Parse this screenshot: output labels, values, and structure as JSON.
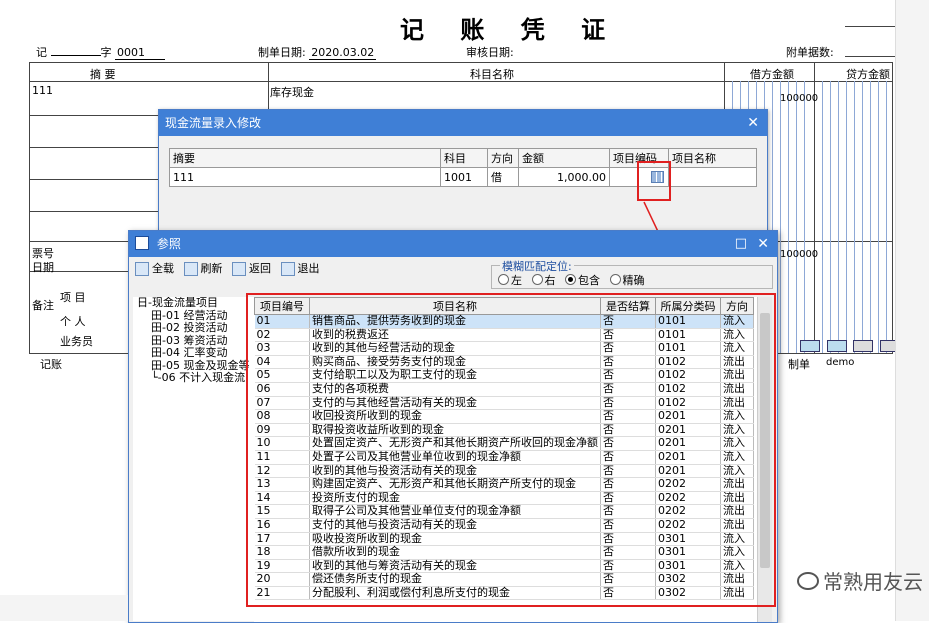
{
  "voucher": {
    "title": "记 账 凭 证",
    "type_label": "记",
    "num_prefix": "字",
    "num_value": "0001",
    "make_date_label": "制单日期:",
    "make_date": "2020.03.02",
    "audit_date_label": "审核日期:",
    "attach_label": "附单据数:",
    "col_summary": "摘 要",
    "col_account": "科目名称",
    "col_debit": "借方金额",
    "col_credit": "贷方金额",
    "row1_summary": "111",
    "row1_account": "库存现金",
    "row1_debit": "100000",
    "total_debit": "100000",
    "bill_no_label": "票号",
    "date_label": "日期",
    "remark_label": "备注",
    "project_label": "项 目",
    "person_label": "个 人",
    "salesman_label": "业务员",
    "bookkeep_label": "记账",
    "maker_label": "制单",
    "maker_value": "demo"
  },
  "cashflow_dialog": {
    "title": "现金流量录入修改",
    "headers": [
      "摘要",
      "科目",
      "方向",
      "金额",
      "项目编码",
      "项目名称"
    ],
    "row": {
      "summary": "111",
      "account": "1001",
      "direction": "借",
      "amount": "1,000.00",
      "code": "",
      "name": ""
    }
  },
  "ref_dialog": {
    "title": "参照",
    "toolbar": [
      "全载",
      "刷新",
      "返回",
      "退出"
    ],
    "fuzzy_label": "模糊匹配定位:",
    "radio_options": [
      "左",
      "右",
      "包含",
      "精确"
    ],
    "radio_selected": 2,
    "tree": [
      "日-现金流量项目",
      "田-01 经营活动",
      "田-02 投资活动",
      "田-03 筹资活动",
      "田-04 汇率变动",
      "田-05 现金及现金等",
      "└-06 不计入现金流"
    ],
    "columns": [
      "项目编号",
      "项目名称",
      "是否结算",
      "所属分类码",
      "方向"
    ],
    "rows": [
      [
        "01",
        "销售商品、提供劳务收到的现金",
        "否",
        "0101",
        "流入"
      ],
      [
        "02",
        "收到的税费返还",
        "否",
        "0101",
        "流入"
      ],
      [
        "03",
        "收到的其他与经营活动的现金",
        "否",
        "0101",
        "流入"
      ],
      [
        "04",
        "购买商品、接受劳务支付的现金",
        "否",
        "0102",
        "流出"
      ],
      [
        "05",
        "支付给职工以及为职工支付的现金",
        "否",
        "0102",
        "流出"
      ],
      [
        "06",
        "支付的各项税费",
        "否",
        "0102",
        "流出"
      ],
      [
        "07",
        "支付的与其他经营活动有关的现金",
        "否",
        "0102",
        "流出"
      ],
      [
        "08",
        "收回投资所收到的现金",
        "否",
        "0201",
        "流入"
      ],
      [
        "09",
        "取得投资收益所收到的现金",
        "否",
        "0201",
        "流入"
      ],
      [
        "10",
        "处置固定资产、无形资产和其他长期资产所收回的现金净额",
        "否",
        "0201",
        "流入"
      ],
      [
        "11",
        "处置子公司及其他营业单位收到的现金净额",
        "否",
        "0201",
        "流入"
      ],
      [
        "12",
        "收到的其他与投资活动有关的现金",
        "否",
        "0201",
        "流入"
      ],
      [
        "13",
        "购建固定资产、无形资产和其他长期资产所支付的现金",
        "否",
        "0202",
        "流出"
      ],
      [
        "14",
        "投资所支付的现金",
        "否",
        "0202",
        "流出"
      ],
      [
        "15",
        "取得子公司及其他营业单位支付的现金净额",
        "否",
        "0202",
        "流出"
      ],
      [
        "16",
        "支付的其他与投资活动有关的现金",
        "否",
        "0202",
        "流出"
      ],
      [
        "17",
        "吸收投资所收到的现金",
        "否",
        "0301",
        "流入"
      ],
      [
        "18",
        "借款所收到的现金",
        "否",
        "0301",
        "流入"
      ],
      [
        "19",
        "收到的其他与筹资活动有关的现金",
        "否",
        "0301",
        "流入"
      ],
      [
        "20",
        "偿还债务所支付的现金",
        "否",
        "0302",
        "流出"
      ],
      [
        "21",
        "分配股利、利润或偿付利息所支付的现金",
        "否",
        "0302",
        "流出"
      ]
    ]
  },
  "watermark": "常熟用友云"
}
